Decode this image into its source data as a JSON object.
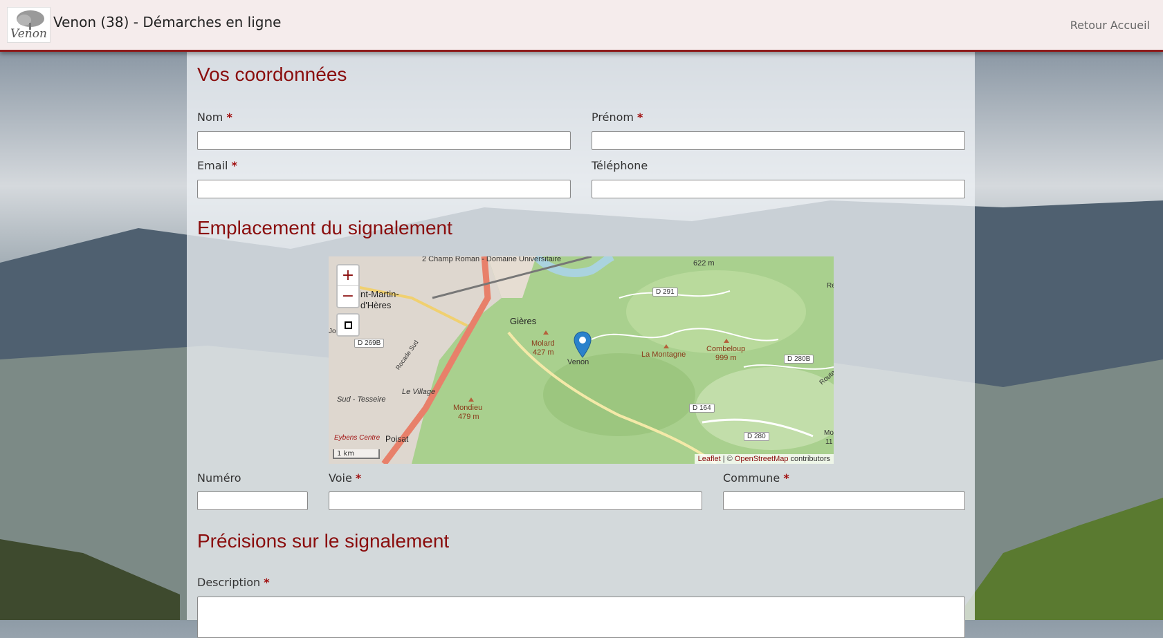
{
  "header": {
    "title": "Venon (38) - Démarches en ligne",
    "logo_text": "Venon",
    "nav_link": "Retour Accueil"
  },
  "sections": {
    "contact": "Vos coordonnées",
    "location": "Emplacement du signalement",
    "details": "Précisions sur le signalement"
  },
  "fields": {
    "nom": {
      "label": "Nom",
      "required": "*",
      "value": ""
    },
    "prenom": {
      "label": "Prénom",
      "required": "*",
      "value": ""
    },
    "email": {
      "label": "Email",
      "required": "*",
      "value": ""
    },
    "telephone": {
      "label": "Téléphone",
      "value": ""
    },
    "numero": {
      "label": "Numéro",
      "value": ""
    },
    "voie": {
      "label": "Voie",
      "required": "*",
      "value": ""
    },
    "commune": {
      "label": "Commune",
      "required": "*",
      "value": ""
    },
    "description": {
      "label": "Description",
      "required": "*",
      "value": ""
    }
  },
  "map": {
    "zoom_in": "+",
    "zoom_out": "−",
    "scale": "1 km",
    "attribution_leaflet": "Leaflet",
    "attribution_sep": " | © ",
    "attribution_osm": "OpenStreetMap",
    "attribution_tail": " contributors",
    "labels": {
      "top": "2 Champ Roman - Domaine Universitaire",
      "saint_martin": "aint-Martin-",
      "dheres": "d'Hères",
      "gieres": "Gières",
      "molard": "Molard",
      "molard_alt": "427 m",
      "venon": "Venon",
      "montagne": "La Montagne",
      "combeloup": "Combeloup",
      "combeloup_alt": "999 m",
      "mondieu": "Mondieu",
      "mondieu_alt": "479 m",
      "le_village": "Le Village",
      "tesseire": "Sud - Tesseire",
      "poisat": "Poisat",
      "eybens": "Eybens Centre",
      "alt_622": "622 m",
      "rocade": "Rocade Sud",
      "route": "Route",
      "mo": "Mo",
      "mo_alt": "11",
      "re": "Re",
      "jo": "Jo"
    },
    "roads": {
      "d291": "D 291",
      "d269b": "D 269B",
      "d280b": "D 280B",
      "d164": "D 164",
      "d280": "D 280"
    },
    "colors": {
      "forest": "#a9d08e",
      "urban": "#e0d8cc",
      "water": "#aad3df",
      "highway": "#e8806a"
    }
  }
}
